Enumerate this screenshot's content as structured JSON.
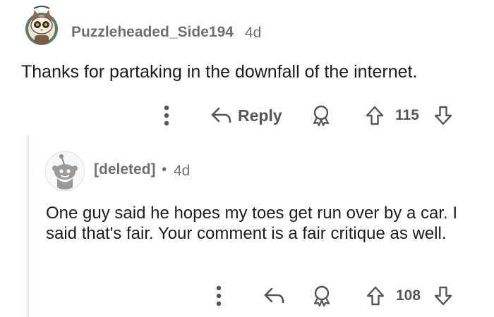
{
  "comment": {
    "author": "Puzzleheaded_Side194",
    "age": "4d",
    "text": "Thanks for partaking in the downfall of the internet.",
    "reply_label": "Reply",
    "score": "115"
  },
  "reply": {
    "author": "[deleted]",
    "separator": "•",
    "age": "4d",
    "text": "One guy said he hopes my toes get run over by a car. I said that's fair. Your comment is a fair critique as well.",
    "score": "108"
  },
  "icons": {
    "more": "more-vertical-icon",
    "reply": "reply-arrow-icon",
    "award": "award-icon",
    "upvote": "upvote-arrow-icon",
    "downvote": "downvote-arrow-icon"
  },
  "colors": {
    "meta_text": "#6f6f6f",
    "body_text": "#1c1c1c",
    "action_icon": "#555555",
    "thread_line": "#e8e8e8",
    "avatar_frame": "#5f7b66"
  }
}
